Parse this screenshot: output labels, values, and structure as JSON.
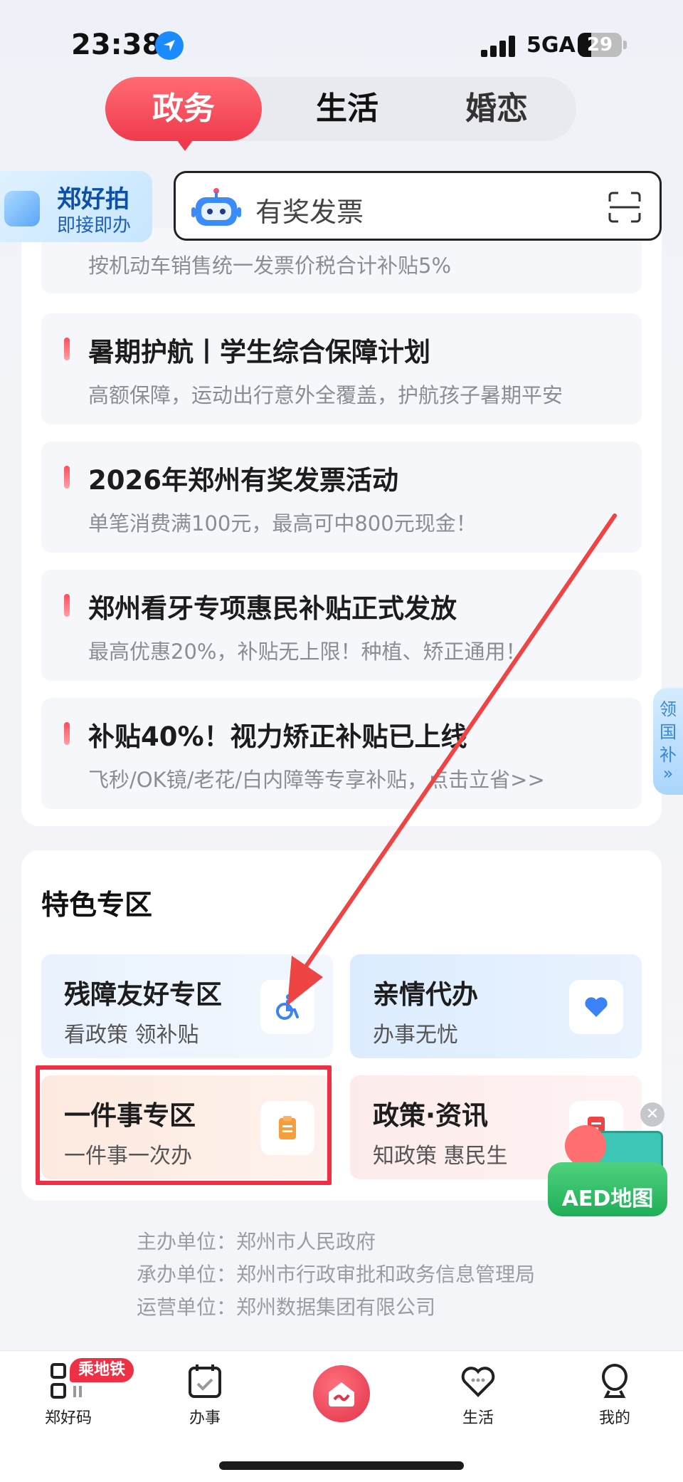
{
  "status_bar": {
    "time": "23:38",
    "network": "5GA",
    "battery": "29"
  },
  "tabs": [
    "政务",
    "生活",
    "婚恋"
  ],
  "brand": {
    "name": "郑好拍",
    "slogan": "即接即办"
  },
  "search": {
    "placeholder": "有奖发票"
  },
  "news_list": {
    "partial_sub": "按机动车销售统一发票价税合计补贴5%",
    "items": [
      {
        "title": "暑期护航丨学生综合保障计划",
        "sub": "高额保障，运动出行意外全覆盖，护航孩子暑期平安"
      },
      {
        "title": "2026年郑州有奖发票活动",
        "sub": "单笔消费满100元，最高可中800元现金！"
      },
      {
        "title": "郑州看牙专项惠民补贴正式发放",
        "sub": "最高优惠20%，补贴无上限！种植、矫正通用！"
      },
      {
        "title": "补贴40%！视力矫正补贴已上线",
        "sub": "飞秒/OK镜/老花/白内障等专享补贴，点击立省>>"
      }
    ]
  },
  "side_tab": [
    "领",
    "国",
    "补",
    "»"
  ],
  "special_zone": {
    "title": "特色专区",
    "tiles": [
      {
        "title": "残障友好专区",
        "sub": "看政策 领补贴",
        "icon": "wheelchair-icon",
        "color": "#3b82f6"
      },
      {
        "title": "亲情代办",
        "sub": "办事无忧",
        "icon": "heart-icon",
        "color": "#3b82f6"
      },
      {
        "title": "一件事专区",
        "sub": "一件事一次办",
        "icon": "clipboard-icon",
        "color": "#f59e3b"
      },
      {
        "title": "政策·资讯",
        "sub": "知政策 惠民生",
        "icon": "document-icon",
        "color": "#ef4444"
      }
    ]
  },
  "aed": {
    "label": "AED地图"
  },
  "footer": [
    "主办单位：郑州市人民政府",
    "承办单位：郑州市行政审批和政务信息管理局",
    "运营单位：郑州数据集团有限公司"
  ],
  "bottom_nav": {
    "items": [
      "郑好码",
      "办事",
      "生活",
      "我的"
    ],
    "badge": "乘地铁"
  }
}
